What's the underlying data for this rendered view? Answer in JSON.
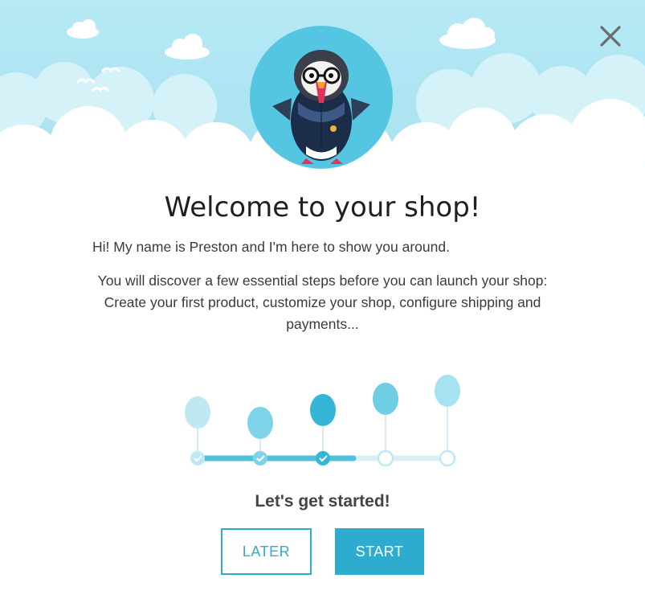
{
  "dialog": {
    "title": "Welcome to your shop!",
    "intro": "Hi! My name is Preston and I'm here to show you around.",
    "description": "You will discover a few essential steps before you can launch your shop: Create your first product, customize your shop, configure shipping and payments...",
    "cta": "Let's get started!",
    "later_label": "LATER",
    "start_label": "START"
  },
  "progress": {
    "total_steps": 5,
    "completed_steps": 3
  },
  "colors": {
    "accent": "#2eacd0",
    "sky": "#b3e7f3",
    "mascot_bg": "#55c6e1"
  },
  "icons": {
    "close": "close-icon",
    "mascot": "puffin-mascot",
    "step_done": "check-icon",
    "step_balloon": "balloon-icon"
  }
}
